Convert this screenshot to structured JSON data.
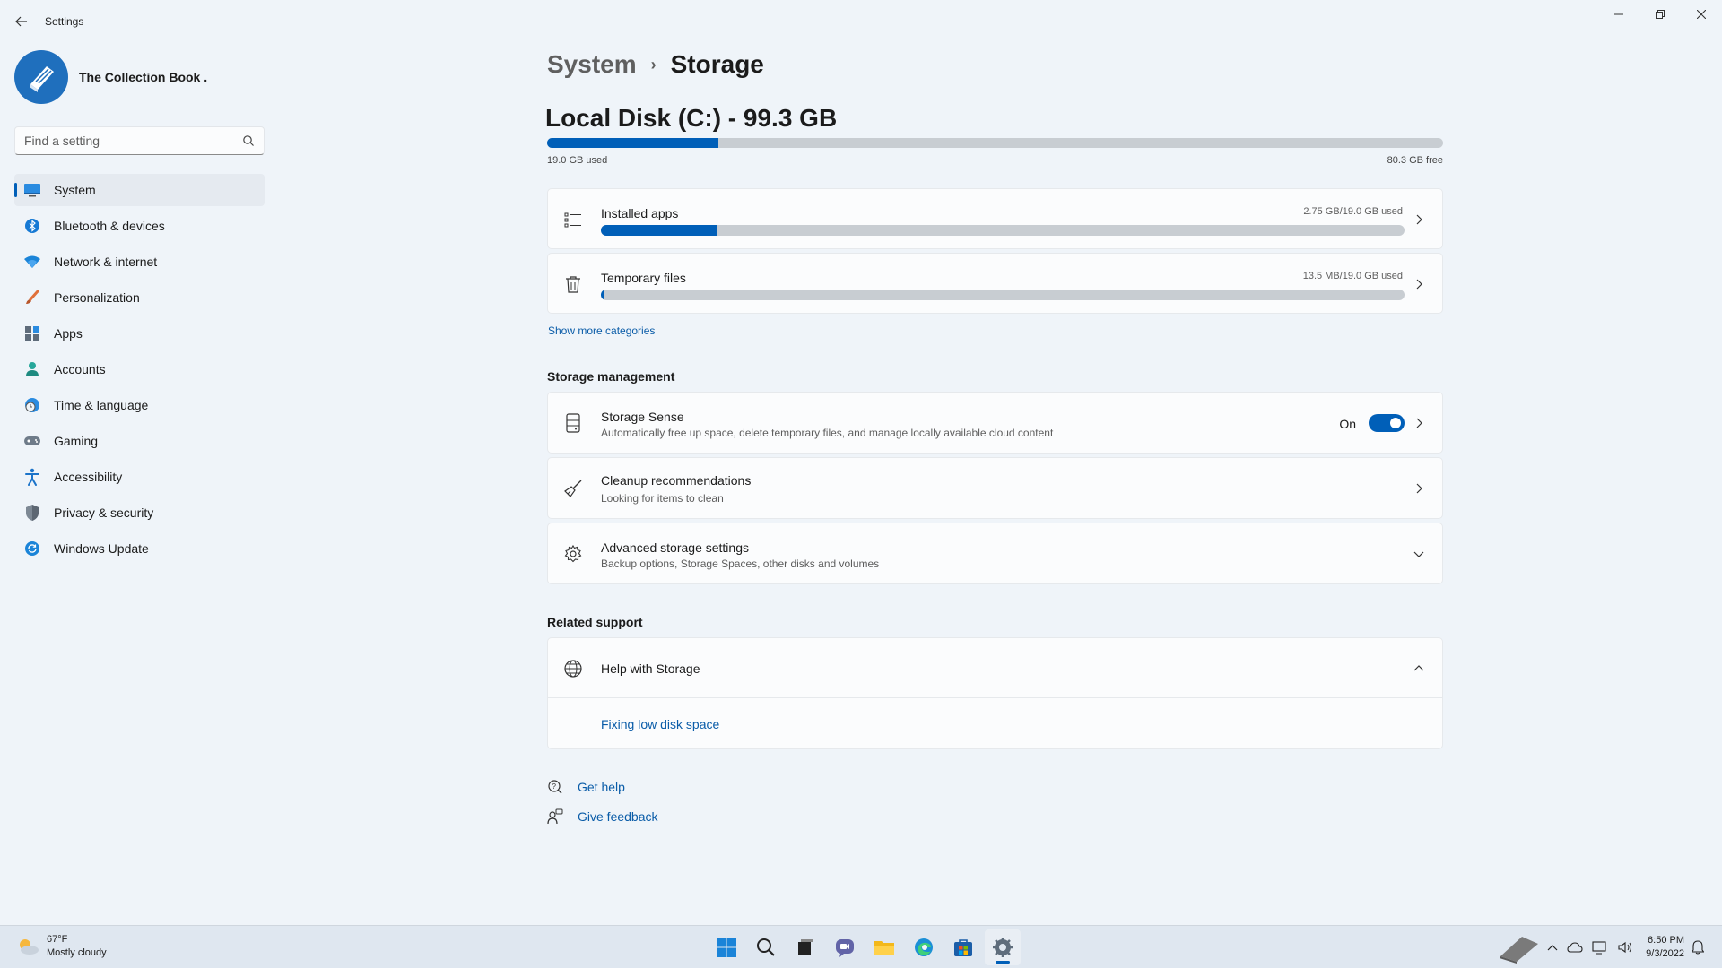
{
  "window": {
    "title": "Settings",
    "back_icon": "back-arrow-icon",
    "minimize_icon": "minimize-icon",
    "maximize_icon": "restore-icon",
    "close_icon": "close-icon"
  },
  "profile": {
    "name": "The Collection Book ."
  },
  "search": {
    "placeholder": "Find a setting"
  },
  "sidebar": {
    "items": [
      {
        "label": "System",
        "icon": "monitor-icon",
        "active": true
      },
      {
        "label": "Bluetooth & devices",
        "icon": "bluetooth-icon"
      },
      {
        "label": "Network & internet",
        "icon": "wifi-icon"
      },
      {
        "label": "Personalization",
        "icon": "brush-icon"
      },
      {
        "label": "Apps",
        "icon": "apps-icon"
      },
      {
        "label": "Accounts",
        "icon": "person-icon"
      },
      {
        "label": "Time & language",
        "icon": "globe-clock-icon"
      },
      {
        "label": "Gaming",
        "icon": "gamepad-icon"
      },
      {
        "label": "Accessibility",
        "icon": "accessibility-icon"
      },
      {
        "label": "Privacy & security",
        "icon": "shield-icon"
      },
      {
        "label": "Windows Update",
        "icon": "update-icon"
      }
    ]
  },
  "breadcrumb": {
    "parent": "System",
    "separator": "›",
    "current": "Storage"
  },
  "disk": {
    "title": "Local Disk (C:) - 99.3 GB",
    "used_label": "19.0 GB used",
    "free_label": "80.3 GB free",
    "used_fraction": 0.191
  },
  "categories": [
    {
      "label": "Installed apps",
      "usage": "2.75 GB/19.0 GB used",
      "fraction": 0.145,
      "icon": "list-icon"
    },
    {
      "label": "Temporary files",
      "usage": "13.5 MB/19.0 GB used",
      "fraction": 0.001,
      "icon": "trash-icon"
    }
  ],
  "show_more": "Show more categories",
  "storage_management": {
    "heading": "Storage management",
    "sense": {
      "title": "Storage Sense",
      "subtitle": "Automatically free up space, delete temporary files, and manage locally available cloud content",
      "toggle_label": "On",
      "toggle_on": true
    },
    "cleanup": {
      "title": "Cleanup recommendations",
      "subtitle": "Looking for items to clean"
    },
    "advanced": {
      "title": "Advanced storage settings",
      "subtitle": "Backup options, Storage Spaces, other disks and volumes"
    }
  },
  "related_support": {
    "heading": "Related support",
    "help_title": "Help with Storage",
    "link": "Fixing low disk space"
  },
  "footer_links": {
    "get_help": "Get help",
    "give_feedback": "Give feedback"
  },
  "taskbar": {
    "temperature": "67°F",
    "condition": "Mostly cloudy",
    "time": "6:50 PM",
    "date": "9/3/2022",
    "apps": [
      "start-icon",
      "search-icon",
      "task-view-icon",
      "chat-icon",
      "file-explorer-icon",
      "edge-icon",
      "store-icon",
      "settings-icon"
    ]
  },
  "colors": {
    "accent": "#005fb8",
    "background": "#eff4f9",
    "card": "#fbfcfd",
    "link": "#0a5ca8"
  }
}
